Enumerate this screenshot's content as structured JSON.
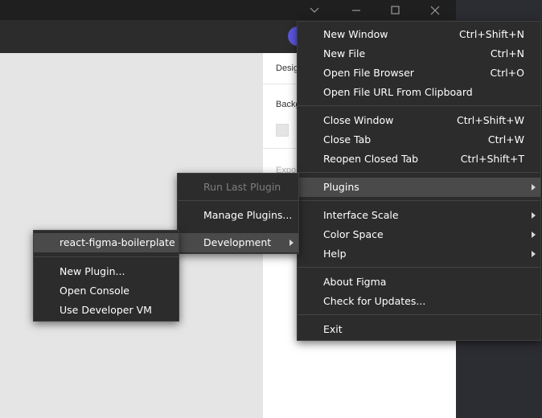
{
  "right_panel": {
    "tab_label": "Desig",
    "background_label": "Backg",
    "export_label": "Expo"
  },
  "main_menu": {
    "new_window": {
      "label": "New Window",
      "shortcut": "Ctrl+Shift+N"
    },
    "new_file": {
      "label": "New File",
      "shortcut": "Ctrl+N"
    },
    "open_file_browser": {
      "label": "Open File Browser",
      "shortcut": "Ctrl+O"
    },
    "open_file_url": {
      "label": "Open File URL From Clipboard"
    },
    "close_window": {
      "label": "Close Window",
      "shortcut": "Ctrl+Shift+W"
    },
    "close_tab": {
      "label": "Close Tab",
      "shortcut": "Ctrl+W"
    },
    "reopen_closed_tab": {
      "label": "Reopen Closed Tab",
      "shortcut": "Ctrl+Shift+T"
    },
    "plugins": {
      "label": "Plugins"
    },
    "interface_scale": {
      "label": "Interface Scale"
    },
    "color_space": {
      "label": "Color Space"
    },
    "help": {
      "label": "Help"
    },
    "about": {
      "label": "About Figma"
    },
    "check_updates": {
      "label": "Check for Updates..."
    },
    "exit": {
      "label": "Exit"
    }
  },
  "plugins_menu": {
    "run_last": {
      "label": "Run Last Plugin"
    },
    "manage": {
      "label": "Manage Plugins..."
    },
    "development": {
      "label": "Development"
    }
  },
  "dev_menu": {
    "boilerplate": {
      "label": "react-figma-boilerplate"
    },
    "new_plugin": {
      "label": "New Plugin..."
    },
    "open_console": {
      "label": "Open Console"
    },
    "use_dev_vm": {
      "label": "Use Developer VM"
    }
  },
  "icons": {
    "window_controls": [
      "chevron-down-icon",
      "minimize-icon",
      "maximize-icon",
      "close-icon"
    ],
    "submenu": "chevron-right-icon"
  },
  "colors": {
    "menu_bg": "#2c2c2c",
    "menu_highlight": "#4a4a4a",
    "canvas_bg": "#e5e5e5",
    "avatar": "#5b57e0"
  }
}
